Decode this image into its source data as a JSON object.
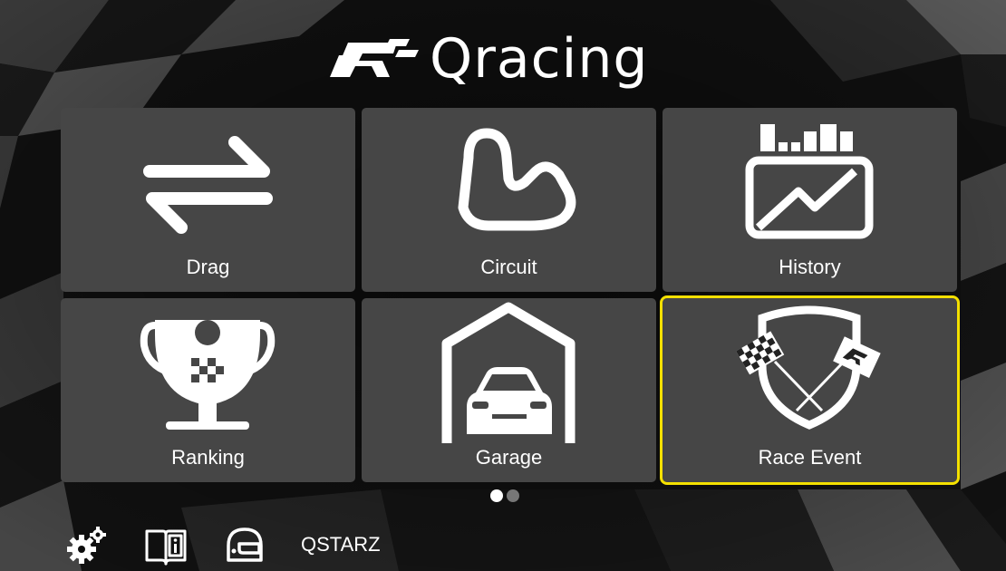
{
  "app": {
    "logo_text": "Qracing"
  },
  "tiles": [
    {
      "label": "Drag",
      "icon": "drag-arrows-icon",
      "selected": false
    },
    {
      "label": "Circuit",
      "icon": "circuit-track-icon",
      "selected": false
    },
    {
      "label": "History",
      "icon": "history-chart-icon",
      "selected": false
    },
    {
      "label": "Ranking",
      "icon": "trophy-icon",
      "selected": false
    },
    {
      "label": "Garage",
      "icon": "garage-car-icon",
      "selected": false
    },
    {
      "label": "Race Event",
      "icon": "checkered-flags-shield-icon",
      "selected": true
    }
  ],
  "pager": {
    "pages": 2,
    "active": 1
  },
  "bottom_bar": {
    "icons": [
      "gears-icon",
      "manual-book-icon",
      "helmet-icon"
    ],
    "brand": "QSTARZ"
  },
  "colors": {
    "tile_bg": "#464646",
    "selected_outline": "#f4e000",
    "background": "#0d0d0d"
  }
}
